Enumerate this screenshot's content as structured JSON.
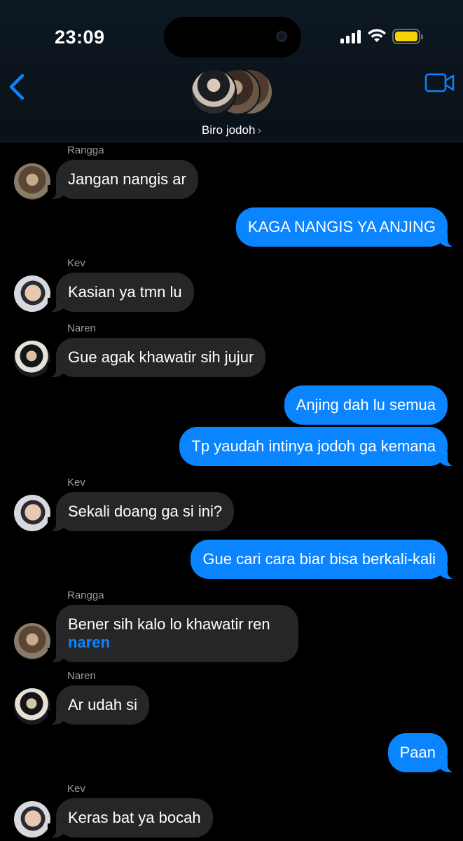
{
  "status_bar": {
    "time": "23:09"
  },
  "header": {
    "group_name": "Biro jodoh",
    "chevron": "›"
  },
  "icons": {
    "back": "chevron-left-icon",
    "video": "video-camera-icon",
    "signal": "cellular-signal-icon",
    "wifi": "wifi-icon",
    "battery": "battery-icon"
  },
  "colors": {
    "accent": "#0a84ff",
    "incoming_bubble": "#262629",
    "background": "#000000",
    "battery": "#f6d308"
  },
  "messages": [
    {
      "sender": "Rangga",
      "text": "Jangan nangis ar",
      "direction": "in"
    },
    {
      "text": "KAGA NANGIS YA ANJING",
      "direction": "out"
    },
    {
      "sender": "Kev",
      "text": "Kasian ya tmn lu",
      "direction": "in"
    },
    {
      "sender": "Naren",
      "text": "Gue agak khawatir sih jujur",
      "direction": "in"
    },
    {
      "text": "Anjing dah lu semua",
      "direction": "out"
    },
    {
      "text": "Tp yaudah intinya jodoh ga kemana",
      "direction": "out"
    },
    {
      "sender": "Kev",
      "text": "Sekali doang ga si ini?",
      "direction": "in"
    },
    {
      "text": "Gue cari cara biar bisa berkali-kali",
      "direction": "out"
    },
    {
      "sender": "Rangga",
      "text": "Bener sih kalo lo khawatir ren",
      "mention": "naren",
      "direction": "in"
    },
    {
      "sender": "Naren",
      "text": "Ar udah si",
      "direction": "in"
    },
    {
      "text": "Paan",
      "direction": "out"
    },
    {
      "sender": "Kev",
      "text": "Keras bat ya bocah",
      "direction": "in"
    }
  ]
}
